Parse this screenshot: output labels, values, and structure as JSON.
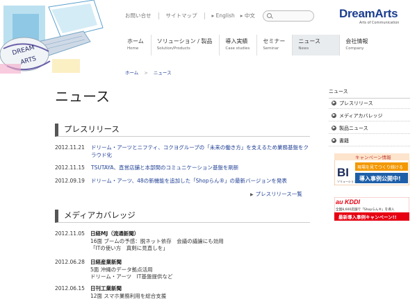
{
  "utility": {
    "contact": "お問い合せ",
    "sitemap": "サイトマップ",
    "english": "English",
    "chinese": "中文"
  },
  "brand": {
    "name": "DreamArts",
    "tagline": "Arts of Communication"
  },
  "nav": [
    {
      "ja": "ホーム",
      "en": "Home"
    },
    {
      "ja": "ソリューション / 製品",
      "en": "Solution/Products"
    },
    {
      "ja": "導入実績",
      "en": "Case studies"
    },
    {
      "ja": "セミナー",
      "en": "Seminar"
    },
    {
      "ja": "ニュース",
      "en": "News"
    },
    {
      "ja": "会社情報",
      "en": "Company"
    }
  ],
  "breadcrumb": {
    "home": "ホーム",
    "separator": ">",
    "current": "ニュース"
  },
  "page_title": "ニュース",
  "press": {
    "heading": "プレスリリース",
    "items": [
      {
        "date": "2012.11.21",
        "text": "ドリーム・アーツとニフティ、コクヨグループの「未来の働き方」を支えるため業務基盤をクラウド化"
      },
      {
        "date": "2012.11.15",
        "text": "TSUTAYA、直営店舗と本部間のコミュニケーション基盤を刷新"
      },
      {
        "date": "2012.09.19",
        "text": "ドリーム・アーツ、48の新機能を追加した「Shopらん®」の最新バージョンを発表"
      }
    ],
    "more": "プレスリリース一覧"
  },
  "media": {
    "heading": "メディアカバレッジ",
    "items": [
      {
        "date": "2012.11.05",
        "source": "日経MJ（流通新聞）",
        "lines": [
          "16面 ブームの予感：脱ネット依存　会議の議論にも効用",
          "「ITの使い方　真剣に見直しを」"
        ]
      },
      {
        "date": "2012.06.28",
        "source": "日経産業新聞",
        "lines": [
          "5面 沖縄のデータ拠点活用",
          "ドリーム・アーツ　IT基盤提供など"
        ]
      },
      {
        "date": "2012.06.15",
        "source": "日刊工業新聞",
        "lines": [
          "12面 スマホ業務利用を総合支援"
        ]
      }
    ]
  },
  "sidebar": {
    "heading": "ニュース",
    "items": [
      "プレスリリース",
      "メディアカバレッジ",
      "製品ニュース",
      "書籍"
    ]
  },
  "banner1": {
    "top": "キャンペーン情報",
    "logo": "BI",
    "sub": "ソリューション",
    "line1": "現場を見てつくり続ける",
    "line2": "導入事例公開中!"
  },
  "banner2": {
    "logo": "au KDDI",
    "line1": "全国8,600店舗で「Shopらん®」を導入",
    "line2": "最新導入事例キャンペーン!!"
  },
  "colors": {
    "link": "#1f3f95",
    "brand": "#1c3d8f",
    "banner_orange": "#f39800",
    "banner_red": "#e60012",
    "banner_blue": "#1e5fa8"
  }
}
